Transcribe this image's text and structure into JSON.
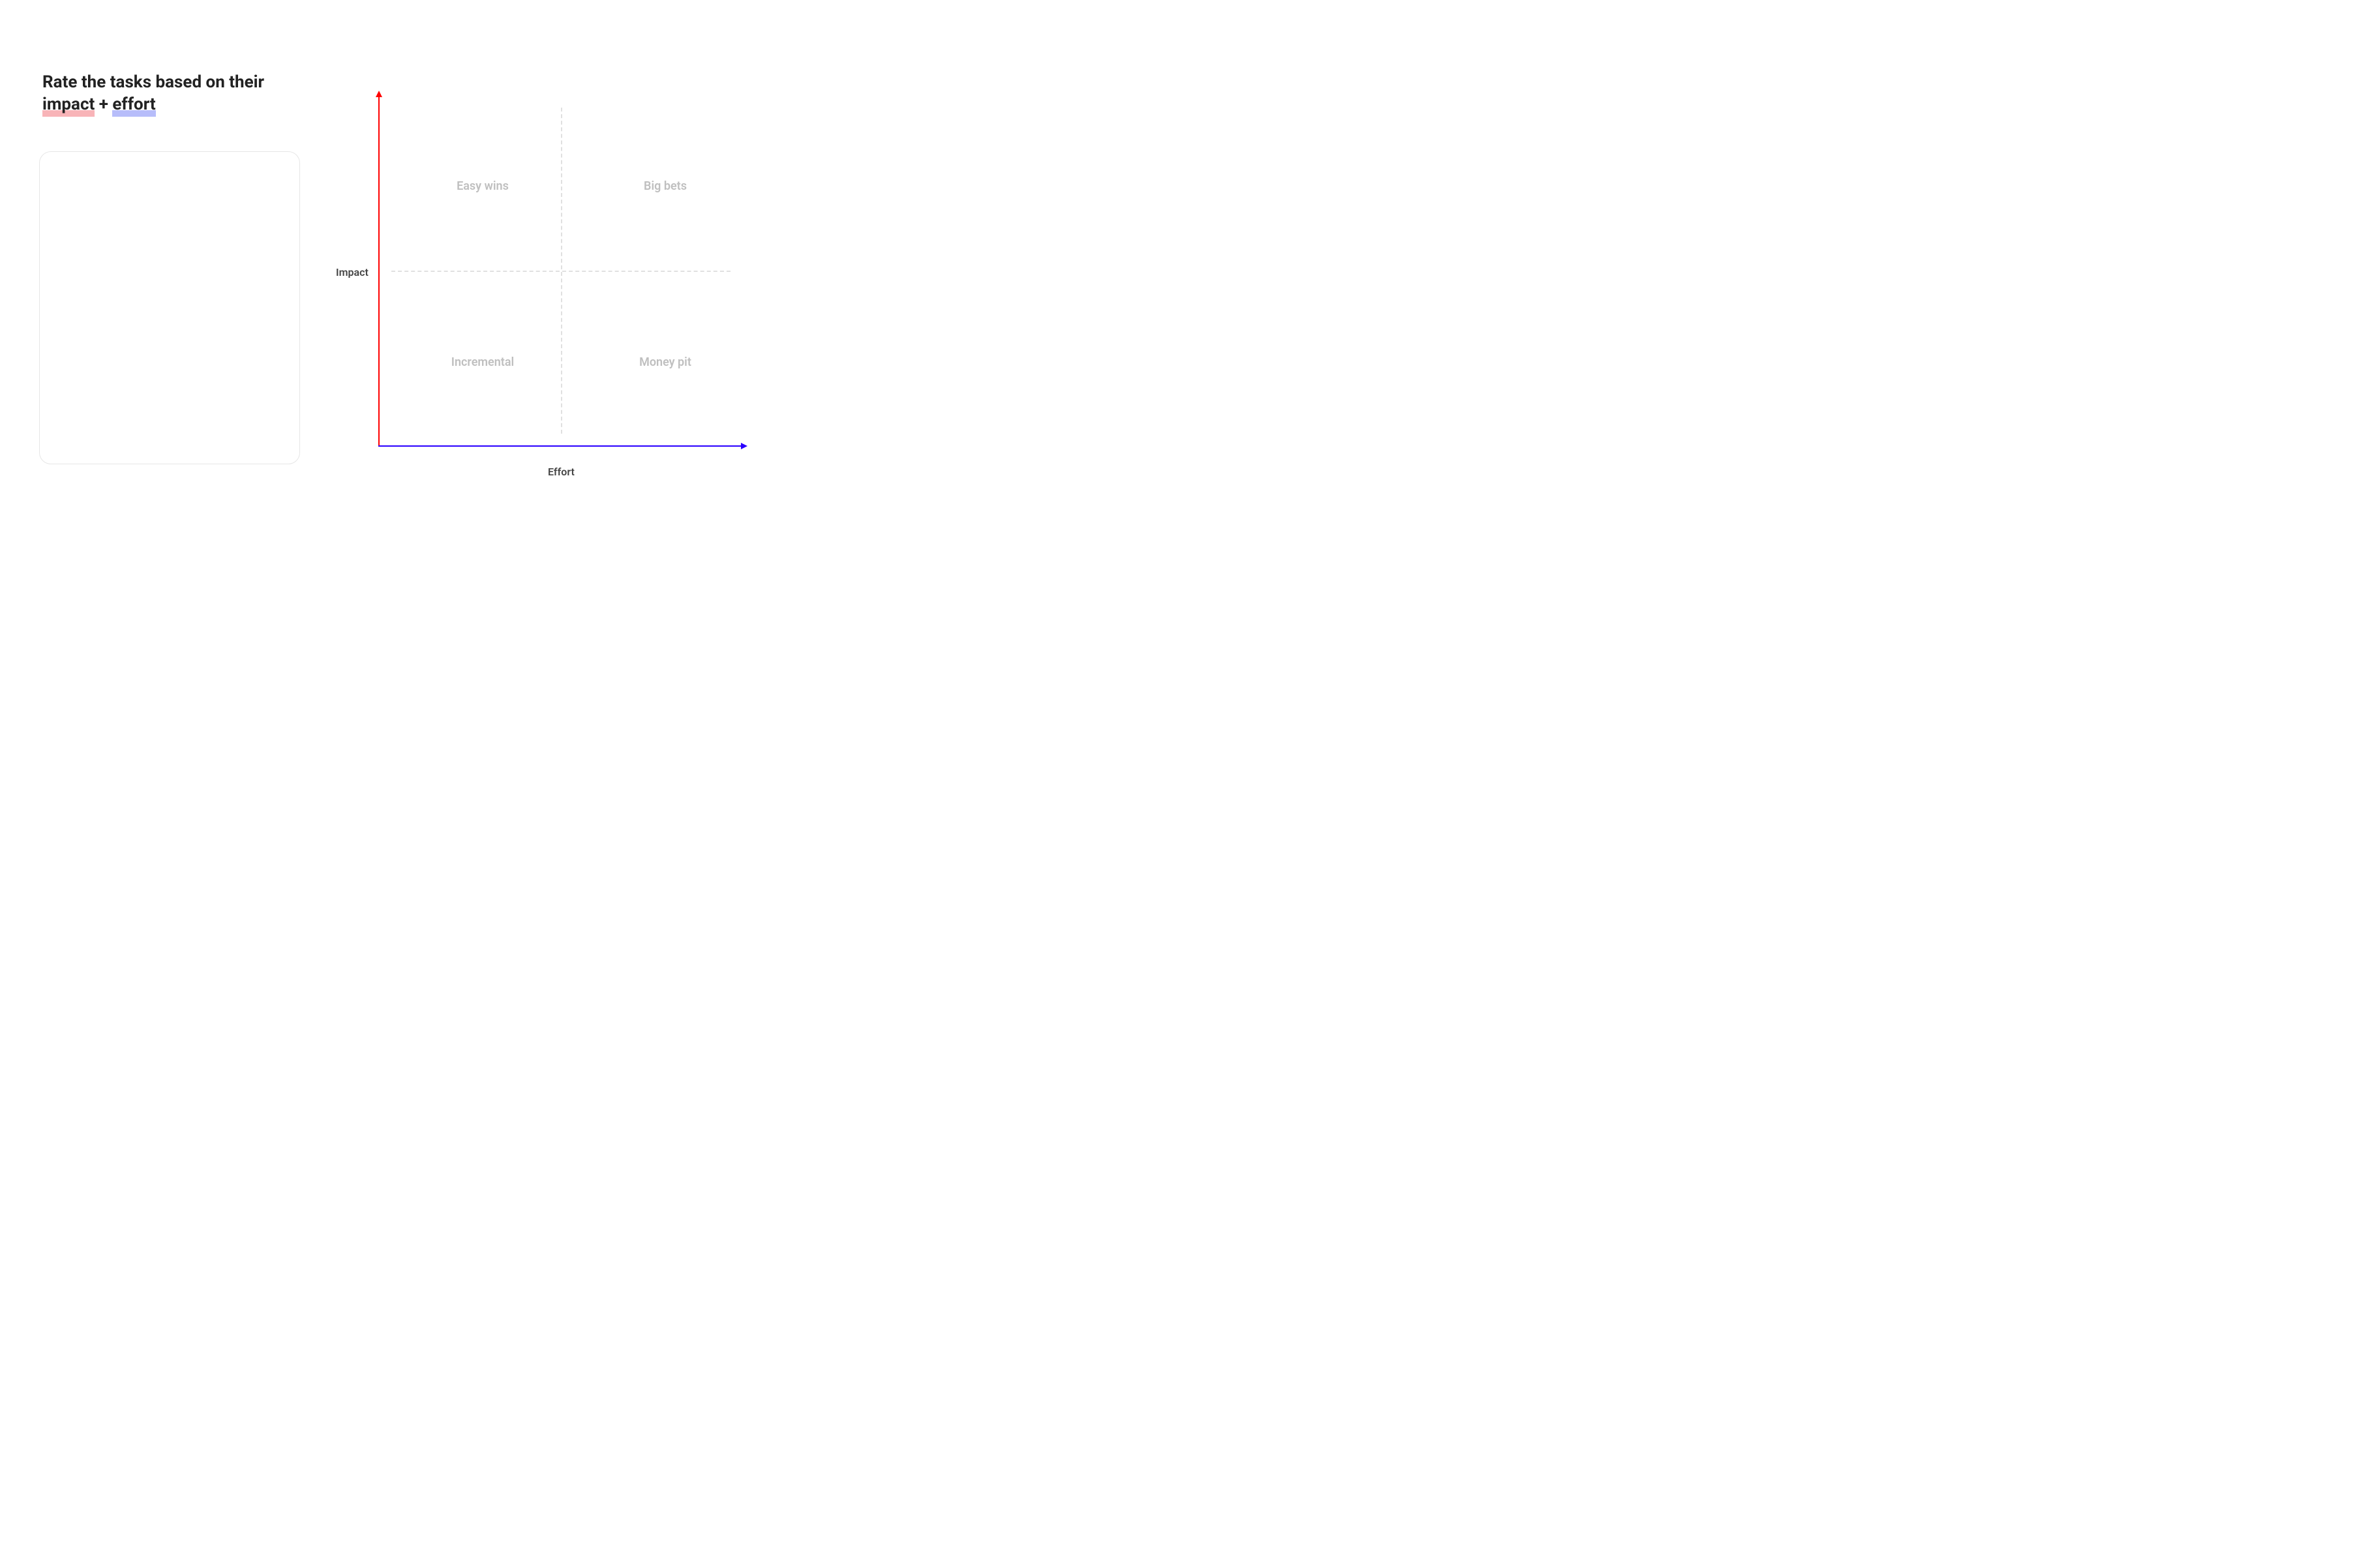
{
  "heading": {
    "prefix": "Rate the tasks based on their ",
    "word_impact": "impact",
    "plus": " + ",
    "word_effort": "effort"
  },
  "chart_data": {
    "type": "quadrant",
    "xlabel": "Effort",
    "ylabel": "Impact",
    "x_axis_direction": "low → high",
    "y_axis_direction": "low → high",
    "quadrants": {
      "top_left": {
        "label": "Easy wins",
        "impact": "high",
        "effort": "low"
      },
      "top_right": {
        "label": "Big bets",
        "impact": "high",
        "effort": "high"
      },
      "bottom_left": {
        "label": "Incremental",
        "impact": "low",
        "effort": "low"
      },
      "bottom_right": {
        "label": "Money pit",
        "impact": "low",
        "effort": "high"
      }
    },
    "colors": {
      "y_axis": "#ff0000",
      "x_axis": "#2a00ff",
      "impact_highlight": "#f8b4b8",
      "effort_highlight": "#b7bdfa"
    }
  }
}
